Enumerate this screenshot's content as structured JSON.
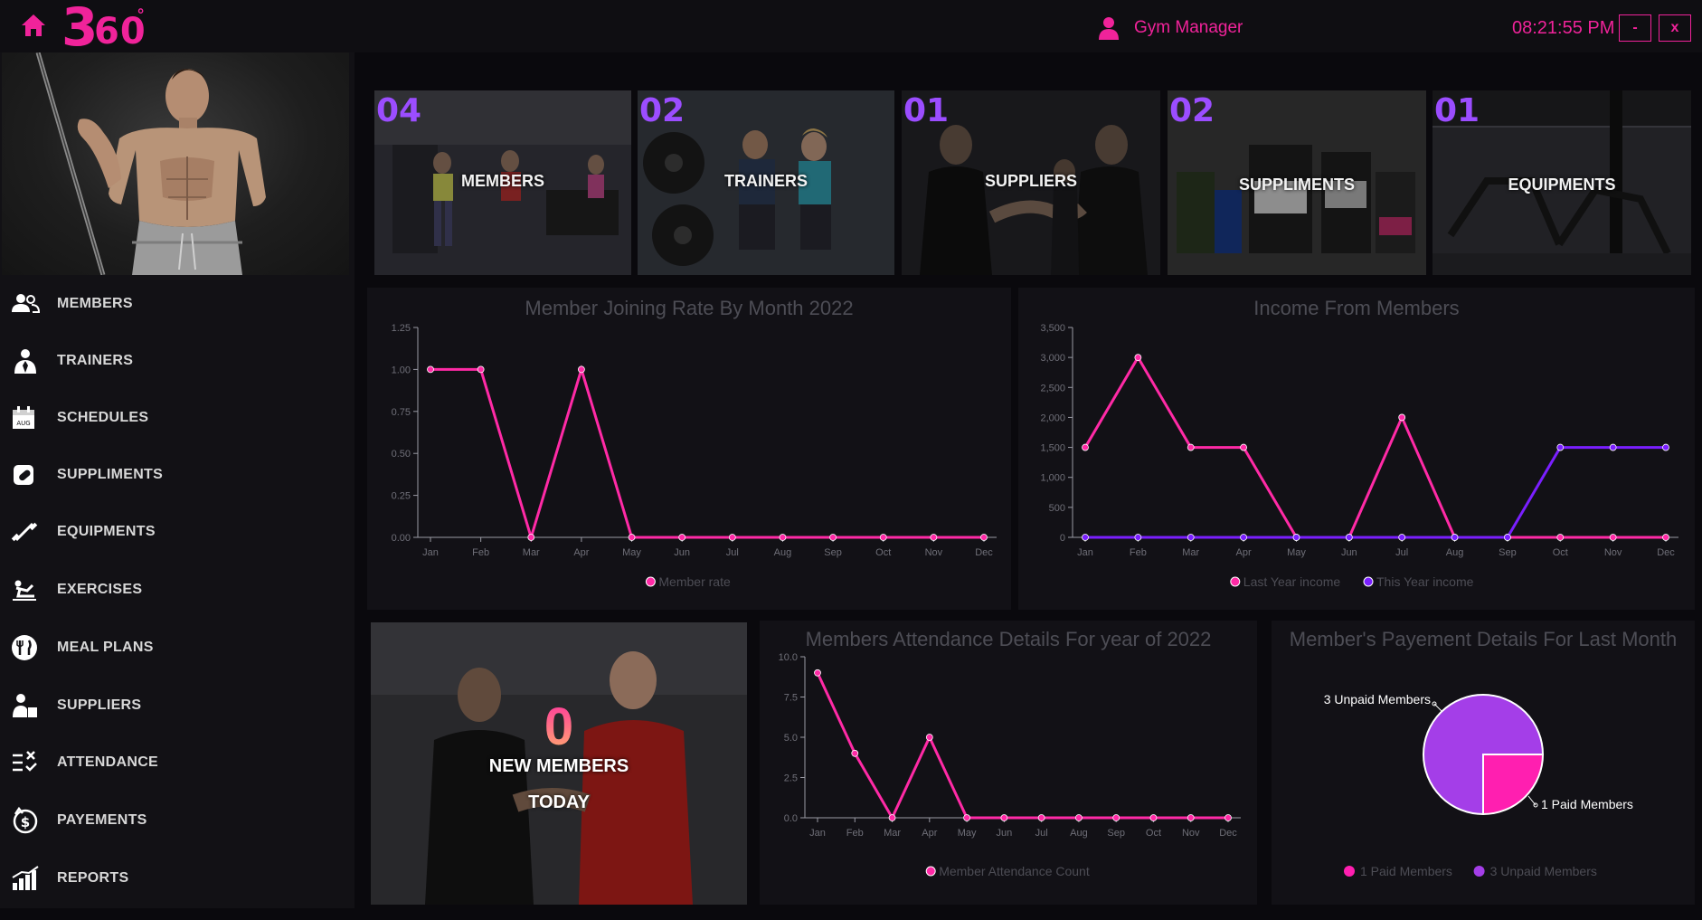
{
  "app": {
    "logo_big": "3",
    "logo_small": "60",
    "logo_deg": "°"
  },
  "header": {
    "user_name": "Gym Manager",
    "clock": "08:21:55 PM",
    "minimize_label": "-",
    "close_label": "x"
  },
  "sidebar": {
    "items": [
      {
        "label": "MEMBERS",
        "icon": "members-icon"
      },
      {
        "label": "TRAINERS",
        "icon": "trainer-icon"
      },
      {
        "label": "SCHEDULES",
        "icon": "calendar-icon"
      },
      {
        "label": "SUPPLIMENTS",
        "icon": "pill-icon"
      },
      {
        "label": "EQUIPMENTS",
        "icon": "dumbbell-icon"
      },
      {
        "label": "EXERCISES",
        "icon": "exercise-icon"
      },
      {
        "label": "MEAL PLANS",
        "icon": "meal-icon"
      },
      {
        "label": "SUPPLIERS",
        "icon": "supplier-icon"
      },
      {
        "label": "ATTENDANCE",
        "icon": "attendance-icon"
      },
      {
        "label": "PAYEMENTS",
        "icon": "payment-icon"
      },
      {
        "label": "REPORTS",
        "icon": "reports-icon"
      }
    ]
  },
  "tiles": [
    {
      "count": "04",
      "label": "MEMBERS"
    },
    {
      "count": "02",
      "label": "TRAINERS"
    },
    {
      "count": "01",
      "label": "SUPPLIERS"
    },
    {
      "count": "02",
      "label": "SUPPLIMENTS"
    },
    {
      "count": "01",
      "label": "EQUIPMENTS"
    }
  ],
  "new_members": {
    "count": "0",
    "line1": "NEW MEMBERS",
    "line2": "TODAY"
  },
  "colors": {
    "accent": "#f0239a",
    "purple": "#9b4dff",
    "line_pink": "#ff2aa6",
    "line_violet": "#7a1fff"
  },
  "chart_data": [
    {
      "type": "line",
      "title": "Member Joining Rate By Month 2022",
      "categories": [
        "Jan",
        "Feb",
        "Mar",
        "Apr",
        "May",
        "Jun",
        "Jul",
        "Aug",
        "Sep",
        "Oct",
        "Nov",
        "Dec"
      ],
      "series": [
        {
          "name": "Member rate",
          "color": "#ff2aa6",
          "values": [
            1,
            1,
            0,
            1,
            0,
            0,
            0,
            0,
            0,
            0,
            0,
            0
          ]
        }
      ],
      "ylim": [
        0,
        1.25
      ],
      "yticks": [
        "0.00",
        "0.25",
        "0.50",
        "0.75",
        "1.00",
        "1.25"
      ],
      "ytick_values": [
        0,
        0.25,
        0.5,
        0.75,
        1,
        1.25
      ],
      "legend": "bottom"
    },
    {
      "type": "line",
      "title": "Income From Members",
      "categories": [
        "Jan",
        "Feb",
        "Mar",
        "Apr",
        "May",
        "Jun",
        "Jul",
        "Aug",
        "Sep",
        "Oct",
        "Nov",
        "Dec"
      ],
      "series": [
        {
          "name": "Last Year income",
          "color": "#ff2aa6",
          "values": [
            1500,
            3000,
            1500,
            1500,
            0,
            0,
            2000,
            0,
            0,
            0,
            0,
            0
          ]
        },
        {
          "name": "This Year income",
          "color": "#7a1fff",
          "values": [
            0,
            0,
            0,
            0,
            0,
            0,
            0,
            0,
            0,
            1500,
            1500,
            1500
          ]
        }
      ],
      "ylim": [
        0,
        3500
      ],
      "yticks": [
        "0",
        "500",
        "1,000",
        "1,500",
        "2,000",
        "2,500",
        "3,000",
        "3,500"
      ],
      "ytick_values": [
        0,
        500,
        1000,
        1500,
        2000,
        2500,
        3000,
        3500
      ],
      "legend": "bottom"
    },
    {
      "type": "line",
      "title": "Members Attendance Details For year of 2022",
      "categories": [
        "Jan",
        "Feb",
        "Mar",
        "Apr",
        "May",
        "Jun",
        "Jul",
        "Aug",
        "Sep",
        "Oct",
        "Nov",
        "Dec"
      ],
      "series": [
        {
          "name": "Member Attendance Count",
          "color": "#ff2aa6",
          "values": [
            9,
            4,
            0,
            5,
            0,
            0,
            0,
            0,
            0,
            0,
            0,
            0
          ]
        }
      ],
      "ylim": [
        0,
        10
      ],
      "yticks": [
        "0.0",
        "2.5",
        "5.0",
        "7.5",
        "10.0"
      ],
      "ytick_values": [
        0,
        2.5,
        5,
        7.5,
        10
      ],
      "legend": "bottom"
    },
    {
      "type": "pie",
      "title": "Member's Payement Details For Last Month",
      "slices": [
        {
          "name": "1 Paid Members",
          "value": 1,
          "color": "#ff1fb0"
        },
        {
          "name": "3 Unpaid Members",
          "value": 3,
          "color": "#a43ee8"
        }
      ],
      "slice_labels": [
        "1 Paid Members",
        "3 Unpaid Members"
      ],
      "legend": "bottom"
    }
  ]
}
